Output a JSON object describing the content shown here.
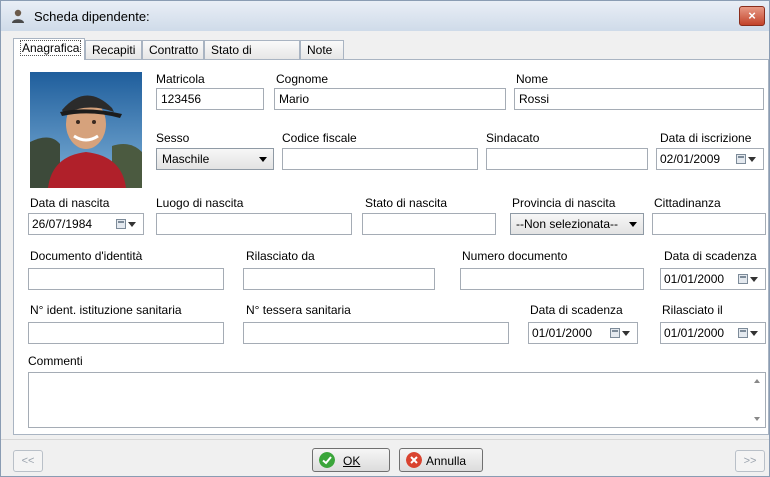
{
  "window": {
    "title": "Scheda dipendente:",
    "close_glyph": "×"
  },
  "tabs": [
    {
      "label": "Anagrafica"
    },
    {
      "label": "Recapiti"
    },
    {
      "label": "Contratto"
    },
    {
      "label": "Stato di famiglia"
    },
    {
      "label": "Note"
    }
  ],
  "form": {
    "matricola": {
      "label": "Matricola",
      "value": "123456"
    },
    "cognome": {
      "label": "Cognome",
      "value": "Mario"
    },
    "nome": {
      "label": "Nome",
      "value": "Rossi"
    },
    "sesso": {
      "label": "Sesso",
      "value": "Maschile"
    },
    "codice_fiscale": {
      "label": "Codice fiscale",
      "value": ""
    },
    "sindacato": {
      "label": "Sindacato",
      "value": ""
    },
    "data_iscrizione": {
      "label": "Data di iscrizione",
      "value": "02/01/2009"
    },
    "data_nascita": {
      "label": "Data di nascita",
      "value": "26/07/1984"
    },
    "luogo_nascita": {
      "label": "Luogo di nascita",
      "value": ""
    },
    "stato_nascita": {
      "label": "Stato di nascita",
      "value": ""
    },
    "provincia_nascita": {
      "label": "Provincia di nascita",
      "value": "--Non selezionata--"
    },
    "cittadinanza": {
      "label": "Cittadinanza",
      "value": ""
    },
    "documento": {
      "label": "Documento d'identità",
      "value": ""
    },
    "rilasciato_da": {
      "label": "Rilasciato da",
      "value": ""
    },
    "numero_documento": {
      "label": "Numero documento",
      "value": ""
    },
    "data_scadenza_doc": {
      "label": "Data di scadenza",
      "value": "01/01/2000"
    },
    "n_ident_sanitaria": {
      "label": "N° ident. istituzione sanitaria",
      "value": ""
    },
    "n_tessera_sanitaria": {
      "label": "N° tessera sanitaria",
      "value": ""
    },
    "data_scadenza_tessera": {
      "label": "Data di scadenza",
      "value": "01/01/2000"
    },
    "rilasciato_il": {
      "label": "Rilasciato il",
      "value": "01/01/2000"
    },
    "commenti": {
      "label": "Commenti",
      "value": ""
    }
  },
  "footer": {
    "prev": "<<",
    "next": ">>",
    "ok": "OK",
    "annulla": "Annulla"
  },
  "icons": {
    "app": "person-icon",
    "calendar": "calendar-icon",
    "ok": "check-icon",
    "cancel": "cancel-icon"
  },
  "colors": {
    "ok_icon": "#3aa53a",
    "cancel_icon": "#d9432f",
    "close_button": "#c2432a"
  }
}
